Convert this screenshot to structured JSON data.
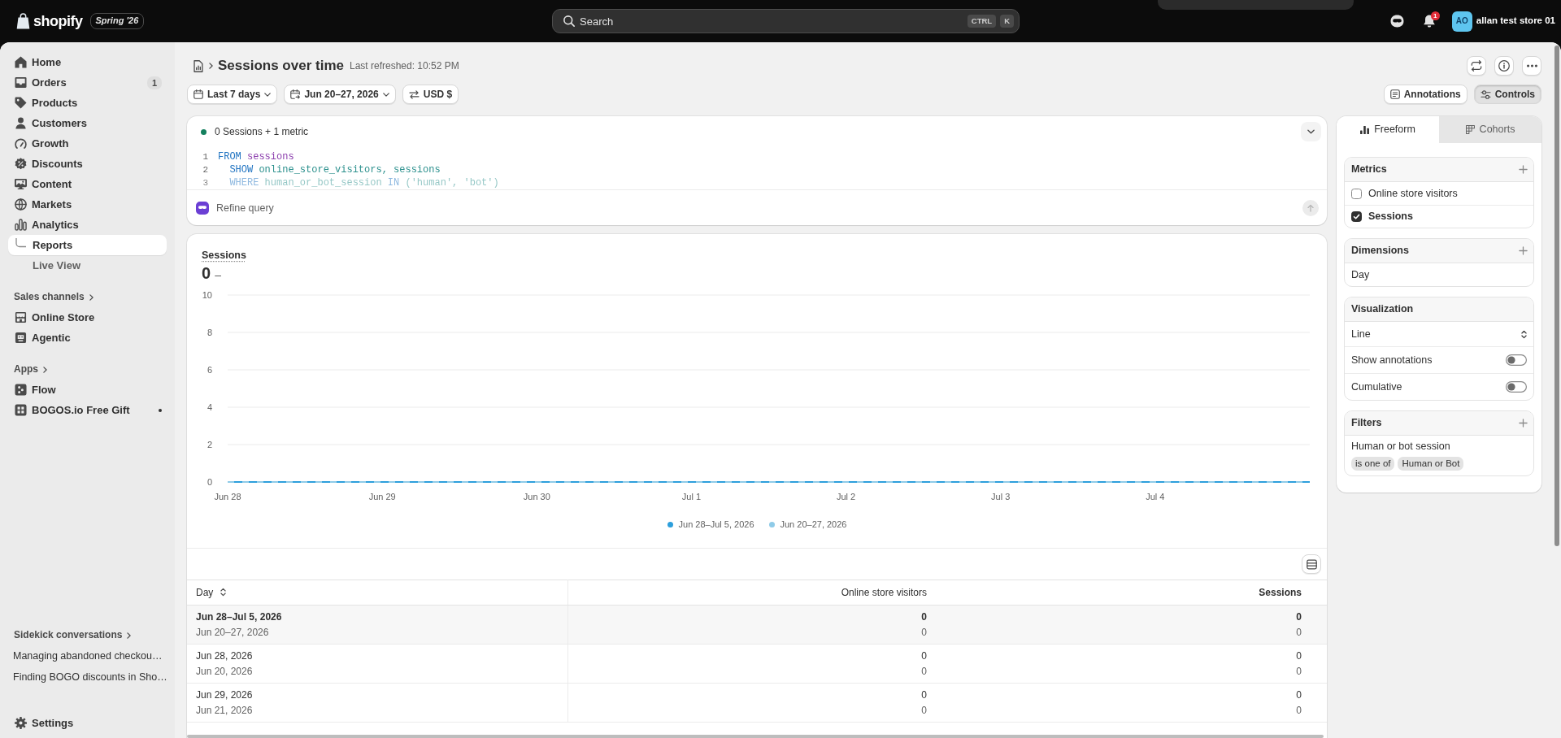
{
  "topbar": {
    "brand": "shopify",
    "edition": "Spring '26",
    "search": {
      "placeholder": "Search",
      "keys": [
        "CTRL",
        "K"
      ]
    },
    "notifications": {
      "count": "1"
    },
    "account": {
      "initials": "AO",
      "name": "allan test store 01"
    }
  },
  "sidebar": {
    "items": [
      {
        "label": "Home",
        "selected": false
      },
      {
        "label": "Orders",
        "badge": "1",
        "selected": false
      },
      {
        "label": "Products",
        "selected": false
      },
      {
        "label": "Customers",
        "selected": false
      },
      {
        "label": "Growth",
        "selected": false
      },
      {
        "label": "Discounts",
        "selected": false
      },
      {
        "label": "Content",
        "selected": false
      },
      {
        "label": "Markets",
        "selected": false
      },
      {
        "label": "Analytics",
        "selected": false,
        "children": [
          {
            "label": "Reports",
            "selected": true
          },
          {
            "label": "Live View",
            "selected": false
          }
        ]
      }
    ],
    "sections": [
      {
        "title": "Sales channels",
        "items": [
          {
            "label": "Online Store",
            "selected": false
          },
          {
            "label": "Agentic",
            "selected": false
          }
        ]
      },
      {
        "title": "Apps",
        "items": [
          {
            "label": "Flow",
            "selected": false,
            "unread": false
          },
          {
            "label": "BOGOS.io Free Gift",
            "selected": false,
            "unread": true
          }
        ]
      }
    ],
    "conversations": {
      "title": "Sidekick conversations",
      "items": [
        "Managing abandoned checkou…",
        "Finding BOGO discounts in Sho…"
      ]
    },
    "settings": "Settings"
  },
  "page": {
    "title": "Sessions over time",
    "refreshed": "Last refreshed: 10:52 PM"
  },
  "toolbar": {
    "filters": [
      {
        "label": "Last 7 days",
        "kind": "dropdown"
      },
      {
        "label": "Jun 20–27, 2026",
        "kind": "dropdown"
      },
      {
        "label": "USD $",
        "kind": "button"
      }
    ],
    "actions": [
      {
        "label": "Annotations",
        "selected": false
      },
      {
        "label": "Controls",
        "selected": true
      }
    ]
  },
  "query": {
    "summary": "0 Sessions + 1 metric",
    "lines": [
      {
        "number": "1",
        "tokens": [
          {
            "text": "FROM",
            "kind": "keyword"
          },
          {
            "text": " sessions",
            "kind": "table"
          }
        ]
      },
      {
        "number": "2",
        "tokens": [
          {
            "text": "  SHOW",
            "kind": "keyword"
          },
          {
            "text": " online_store_visitors, sessions",
            "kind": "field"
          }
        ]
      },
      {
        "number": "3",
        "tokens": [
          {
            "text": "  WHERE",
            "kind": "keyword"
          },
          {
            "text": " human_or_bot_session",
            "kind": "field"
          },
          {
            "text": " IN",
            "kind": "keyword"
          },
          {
            "text": " ('human', 'bot')",
            "kind": "string"
          }
        ]
      }
    ],
    "prompt": {
      "placeholder": "Refine query",
      "send_disabled": true
    }
  },
  "chart": {
    "title": "Sessions",
    "value": "0",
    "change": "–",
    "chart_data": {
      "type": "line",
      "categories": [
        "Jun 28",
        "Jun 29",
        "Jun 30",
        "Jul 1",
        "Jul 2",
        "Jul 3",
        "Jul 4",
        null
      ],
      "ylim": [
        0,
        10
      ],
      "yticks": [
        0,
        2,
        4,
        6,
        8,
        10
      ],
      "grid": true,
      "series": [
        {
          "name": "Jun 28–Jul 5, 2026",
          "color": "#2d9fdc",
          "line_style": "solid",
          "values": [
            0,
            0,
            0,
            0,
            0,
            0,
            0,
            0
          ]
        },
        {
          "name": "Jun 20–27, 2026",
          "color": "#8fcbe8",
          "line_style": "dashed",
          "values": [
            0,
            0,
            0,
            0,
            0,
            0,
            0,
            0
          ]
        }
      ]
    }
  },
  "table": {
    "columns": [
      {
        "label": "Day",
        "sortable": true,
        "emphasized": false
      },
      {
        "label": "Online store visitors",
        "sortable": false,
        "emphasized": false
      },
      {
        "label": "Sessions",
        "sortable": false,
        "emphasized": true
      }
    ],
    "rows": [
      {
        "kind": "total",
        "cells": [
          {
            "value": "Jun 28–Jul 5, 2026",
            "comparison": "Jun 20–27, 2026"
          },
          {
            "value": "0",
            "comparison": "0"
          },
          {
            "value": "0",
            "comparison": "0"
          }
        ]
      },
      {
        "kind": "day",
        "cells": [
          {
            "value": "Jun 28, 2026",
            "comparison": "Jun 20, 2026"
          },
          {
            "value": "0",
            "comparison": "0"
          },
          {
            "value": "0",
            "comparison": "0"
          }
        ]
      },
      {
        "kind": "day",
        "cells": [
          {
            "value": "Jun 29, 2026",
            "comparison": "Jun 21, 2026"
          },
          {
            "value": "0",
            "comparison": "0"
          },
          {
            "value": "0",
            "comparison": "0"
          }
        ]
      }
    ]
  },
  "controls": {
    "tabs": [
      {
        "label": "Freeform",
        "selected": true
      },
      {
        "label": "Cohorts",
        "selected": false
      }
    ],
    "sections": [
      {
        "kind": "checklist",
        "title": "Metrics",
        "addable": true,
        "items": [
          {
            "label": "Online store visitors",
            "checked": false
          },
          {
            "label": "Sessions",
            "checked": true
          }
        ]
      },
      {
        "kind": "list",
        "title": "Dimensions",
        "addable": true,
        "items": [
          {
            "label": "Day"
          }
        ]
      },
      {
        "kind": "settings",
        "title": "Visualization",
        "addable": false,
        "select": "Line",
        "toggles": [
          {
            "label": "Show annotations",
            "on": false
          },
          {
            "label": "Cumulative",
            "on": false
          }
        ]
      },
      {
        "kind": "filters",
        "title": "Filters",
        "addable": true,
        "items": [
          {
            "field": "Human or bot session",
            "operator": "is one of",
            "value": "Human or Bot"
          }
        ]
      }
    ]
  }
}
